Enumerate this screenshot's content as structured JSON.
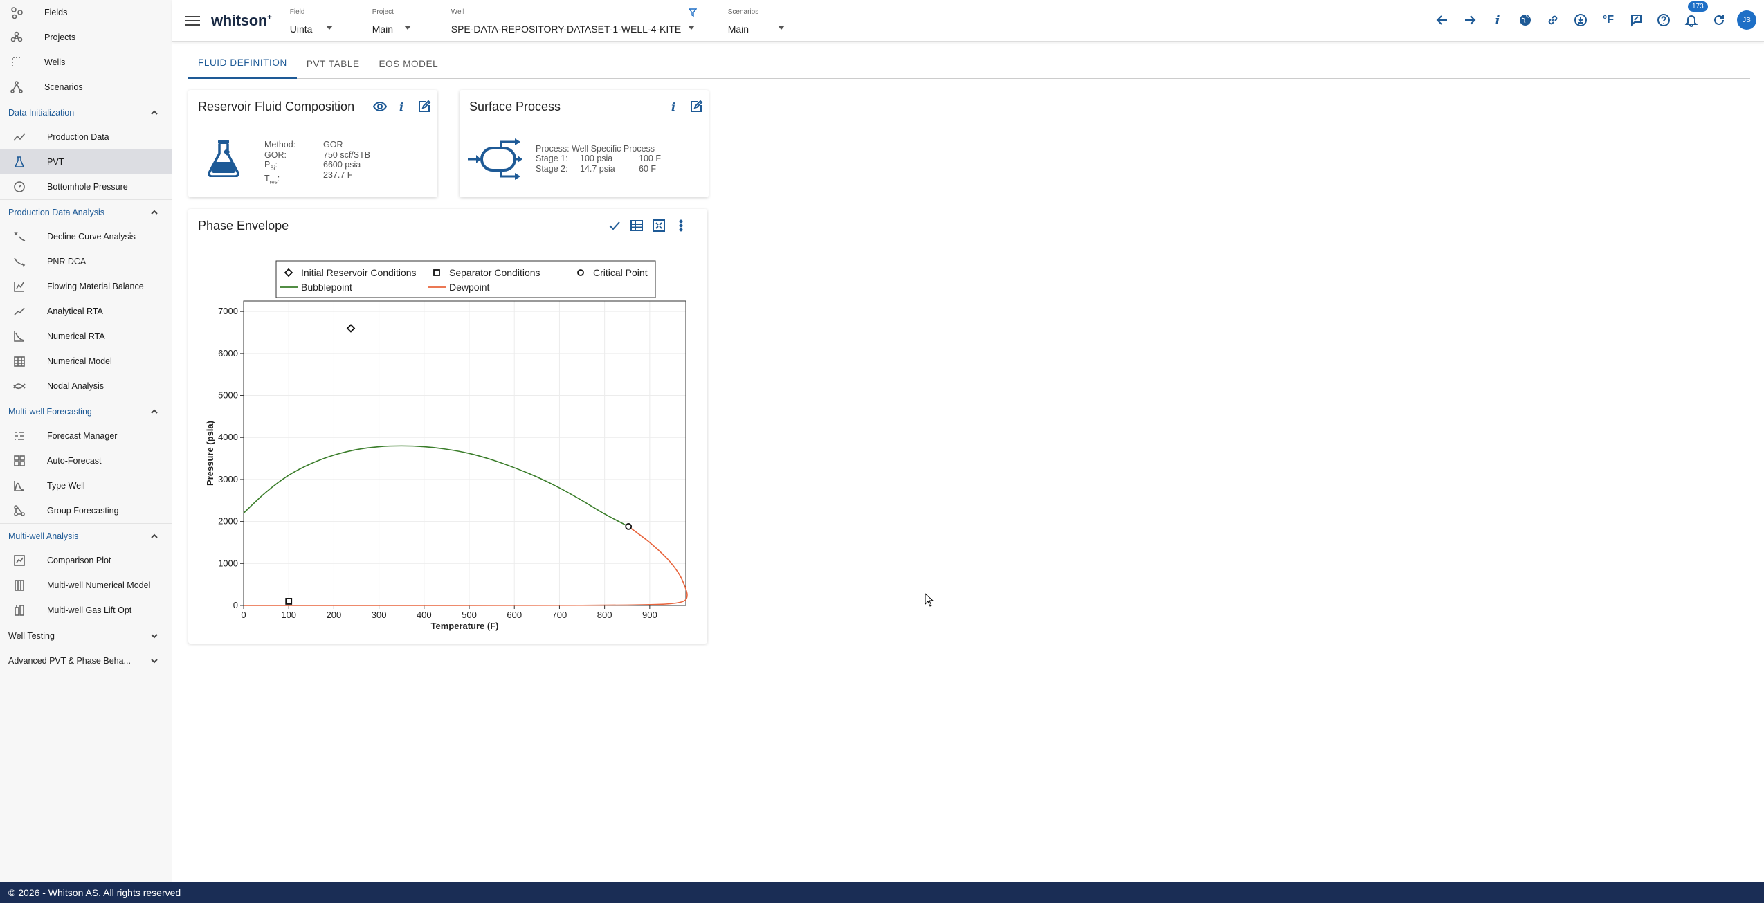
{
  "sidebar": {
    "top_items": [
      {
        "label": "Fields",
        "icon": "fields-icon"
      },
      {
        "label": "Projects",
        "icon": "projects-icon"
      },
      {
        "label": "Wells",
        "icon": "wells-icon"
      },
      {
        "label": "Scenarios",
        "icon": "scenarios-icon"
      }
    ],
    "sections": [
      {
        "title": "Data Initialization",
        "expanded": true,
        "items": [
          {
            "label": "Production Data",
            "icon": "production-data-icon"
          },
          {
            "label": "PVT",
            "icon": "flask-icon",
            "active": true
          },
          {
            "label": "Bottomhole Pressure",
            "icon": "gauge-icon"
          }
        ]
      },
      {
        "title": "Production Data Analysis",
        "expanded": true,
        "items": [
          {
            "label": "Decline Curve Analysis",
            "icon": "decline-icon"
          },
          {
            "label": "PNR DCA",
            "icon": "pnr-icon"
          },
          {
            "label": "Flowing Material Balance",
            "icon": "fmb-icon"
          },
          {
            "label": "Analytical RTA",
            "icon": "analytical-rta-icon"
          },
          {
            "label": "Numerical RTA",
            "icon": "numerical-rta-icon"
          },
          {
            "label": "Numerical Model",
            "icon": "numerical-model-icon"
          },
          {
            "label": "Nodal Analysis",
            "icon": "nodal-icon"
          }
        ]
      },
      {
        "title": "Multi-well Forecasting",
        "expanded": true,
        "items": [
          {
            "label": "Forecast Manager",
            "icon": "forecast-manager-icon"
          },
          {
            "label": "Auto-Forecast",
            "icon": "auto-forecast-icon"
          },
          {
            "label": "Type Well",
            "icon": "type-well-icon"
          },
          {
            "label": "Group Forecasting",
            "icon": "group-forecasting-icon"
          }
        ]
      },
      {
        "title": "Multi-well Analysis",
        "expanded": true,
        "items": [
          {
            "label": "Comparison Plot",
            "icon": "comparison-plot-icon"
          },
          {
            "label": "Multi-well Numerical Model",
            "icon": "multiwell-model-icon"
          },
          {
            "label": "Multi-well Gas Lift Opt",
            "icon": "gas-lift-icon"
          }
        ]
      },
      {
        "title": "Well Testing",
        "expanded": false,
        "items": []
      },
      {
        "title": "Advanced PVT & Phase Beha...",
        "expanded": false,
        "items": []
      }
    ]
  },
  "topbar": {
    "logo": "whitson",
    "logo_sup": "+",
    "field": {
      "label": "Field",
      "value": "Uinta"
    },
    "project": {
      "label": "Project",
      "value": "Main"
    },
    "well": {
      "label": "Well",
      "value": "SPE-DATA-REPOSITORY-DATASET-1-WELL-4-KITE"
    },
    "scenarios": {
      "label": "Scenarios",
      "value": "Main"
    },
    "temp_unit": "°F",
    "notification_count": "173",
    "avatar_initials": "JS"
  },
  "tabs": [
    "FLUID DEFINITION",
    "PVT TABLE",
    "EOS MODEL"
  ],
  "reservoir_card": {
    "title": "Reservoir Fluid Composition",
    "rows": [
      {
        "key": "Method:",
        "value": "GOR"
      },
      {
        "key": "GOR:",
        "value": "750 scf/STB"
      },
      {
        "key": "P",
        "sub": "Bi",
        "value": "6600 psia"
      },
      {
        "key": "T",
        "sub": "res",
        "value": "237.7 F"
      }
    ]
  },
  "surface_card": {
    "title": "Surface Process",
    "process": "Process: Well Specific Process",
    "stages": [
      {
        "label": "Stage 1:",
        "pressure": "100 psia",
        "temp": "100 F"
      },
      {
        "label": "Stage 2:",
        "pressure": "14.7 psia",
        "temp": "60 F"
      }
    ]
  },
  "phase_card": {
    "title": "Phase Envelope"
  },
  "footer": "© 2026 - Whitson AS. All rights reserved",
  "chart_data": {
    "type": "line",
    "xlabel": "Temperature (F)",
    "ylabel": "Pressure (psia)",
    "xlim": [
      0,
      980
    ],
    "ylim": [
      0,
      7250
    ],
    "xticks": [
      0,
      100,
      200,
      300,
      400,
      500,
      600,
      700,
      800,
      900
    ],
    "yticks": [
      0,
      1000,
      2000,
      3000,
      4000,
      5000,
      6000,
      7000
    ],
    "grid": true,
    "legend": [
      {
        "name": "Initial Reservoir Conditions",
        "marker": "diamond"
      },
      {
        "name": "Separator Conditions",
        "marker": "square"
      },
      {
        "name": "Critical Point",
        "marker": "circle"
      },
      {
        "name": "Bubblepoint",
        "line": "#3a7d2a"
      },
      {
        "name": "Dewpoint",
        "line": "#e8643c"
      }
    ],
    "series": [
      {
        "name": "Bubblepoint",
        "color": "#3a7d2a",
        "x": [
          0,
          50,
          100,
          150,
          200,
          250,
          300,
          350,
          400,
          450,
          500,
          550,
          600,
          650,
          700,
          750,
          800,
          853
        ],
        "y": [
          2200,
          2700,
          3100,
          3380,
          3580,
          3710,
          3780,
          3800,
          3780,
          3720,
          3620,
          3470,
          3280,
          3060,
          2800,
          2500,
          2180,
          1880
        ]
      },
      {
        "name": "Dewpoint",
        "color": "#e8643c",
        "x": [
          853,
          900,
          940,
          965,
          978,
          983,
          978,
          960,
          920,
          850,
          750,
          600,
          400,
          200,
          0
        ],
        "y": [
          1880,
          1500,
          1100,
          750,
          450,
          250,
          120,
          60,
          25,
          10,
          4,
          2,
          1,
          0.5,
          0
        ]
      }
    ],
    "points": [
      {
        "name": "Initial Reservoir Conditions",
        "x": 237.7,
        "y": 6600,
        "marker": "diamond"
      },
      {
        "name": "Separator Conditions",
        "x": 100,
        "y": 100,
        "marker": "square"
      },
      {
        "name": "Critical Point",
        "x": 853,
        "y": 1880,
        "marker": "circle"
      }
    ]
  }
}
